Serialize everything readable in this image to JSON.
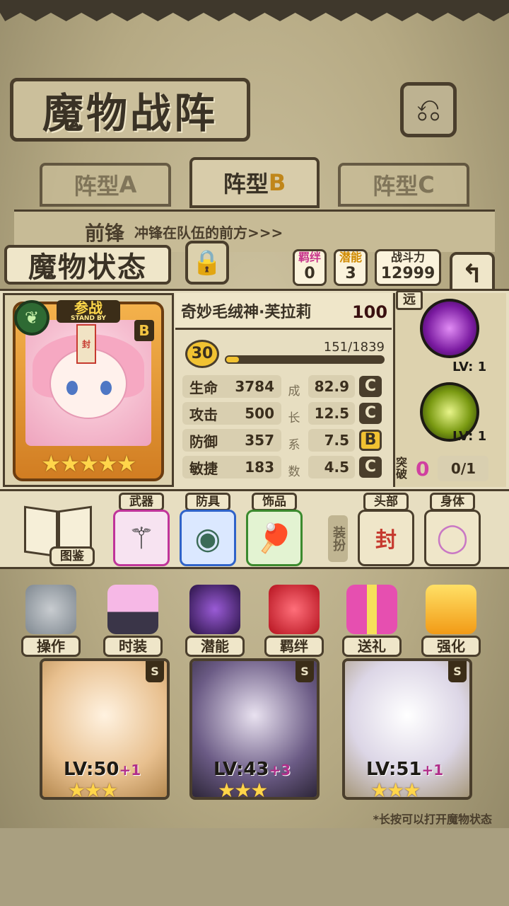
{
  "header": {
    "title": "魔物战阵"
  },
  "formation_tabs": [
    {
      "label": "阵型",
      "letter": "A"
    },
    {
      "label": "阵型",
      "letter": "B"
    },
    {
      "label": "阵型",
      "letter": "C"
    }
  ],
  "front_row": {
    "label": "前锋",
    "desc": "冲锋在队伍的前方>>>"
  },
  "status": {
    "title": "魔物状态",
    "bond_label": "羁绊",
    "bond_value": "0",
    "potential_label": "潜能",
    "potential_value": "3",
    "power_label": "战斗力",
    "power_value": "12999"
  },
  "monster": {
    "name": "奇妙毛绒神·芙拉莉",
    "affection": "100",
    "standby": "参战",
    "standby_en": "STAND BY",
    "rank": "B",
    "stars": "★★★★★",
    "talisman": "封",
    "level": "30",
    "exp": "151/1839",
    "exp_fraction": 0.082,
    "range": "远"
  },
  "stats": [
    {
      "name": "生命",
      "value": "3784",
      "growth": "82.9",
      "grade": "C"
    },
    {
      "name": "攻击",
      "value": "500",
      "growth": "12.5",
      "grade": "C"
    },
    {
      "name": "防御",
      "value": "357",
      "growth": "7.5",
      "grade": "B"
    },
    {
      "name": "敏捷",
      "value": "183",
      "growth": "4.5",
      "grade": "C"
    }
  ],
  "growth_vertical": [
    "成",
    "长",
    "系",
    "数"
  ],
  "skills": [
    {
      "level": "LV: 1",
      "icon": "star-burst-icon"
    },
    {
      "level": "LV: 1",
      "icon": "shield-orb-icon"
    }
  ],
  "breakthrough": {
    "label": "突破",
    "count": "0",
    "progress": "0/1"
  },
  "equipment": {
    "handbook": "图鉴",
    "weapon": "武器",
    "armor": "防具",
    "accessory": "饰品",
    "equip_vertical": "装扮",
    "head": "头部",
    "body": "身体"
  },
  "actions": [
    {
      "label": "操作"
    },
    {
      "label": "时装"
    },
    {
      "label": "潜能"
    },
    {
      "label": "羁绊"
    },
    {
      "label": "送礼"
    },
    {
      "label": "强化"
    }
  ],
  "roster": [
    {
      "level": "LV:50",
      "plus": "+1",
      "stars": "★★★",
      "rank": "S"
    },
    {
      "level": "LV:43",
      "plus": "+3",
      "stars": "★★★",
      "rank": "S"
    },
    {
      "level": "LV:51",
      "plus": "+1",
      "stars": "★★★",
      "rank": "S"
    }
  ],
  "hint": "*长按可以打开魔物状态",
  "colors": {
    "accent_gold": "#f1c232",
    "heart_red": "#d3323a",
    "ink": "#4a3e2c",
    "parchment": "#e7dec1"
  }
}
